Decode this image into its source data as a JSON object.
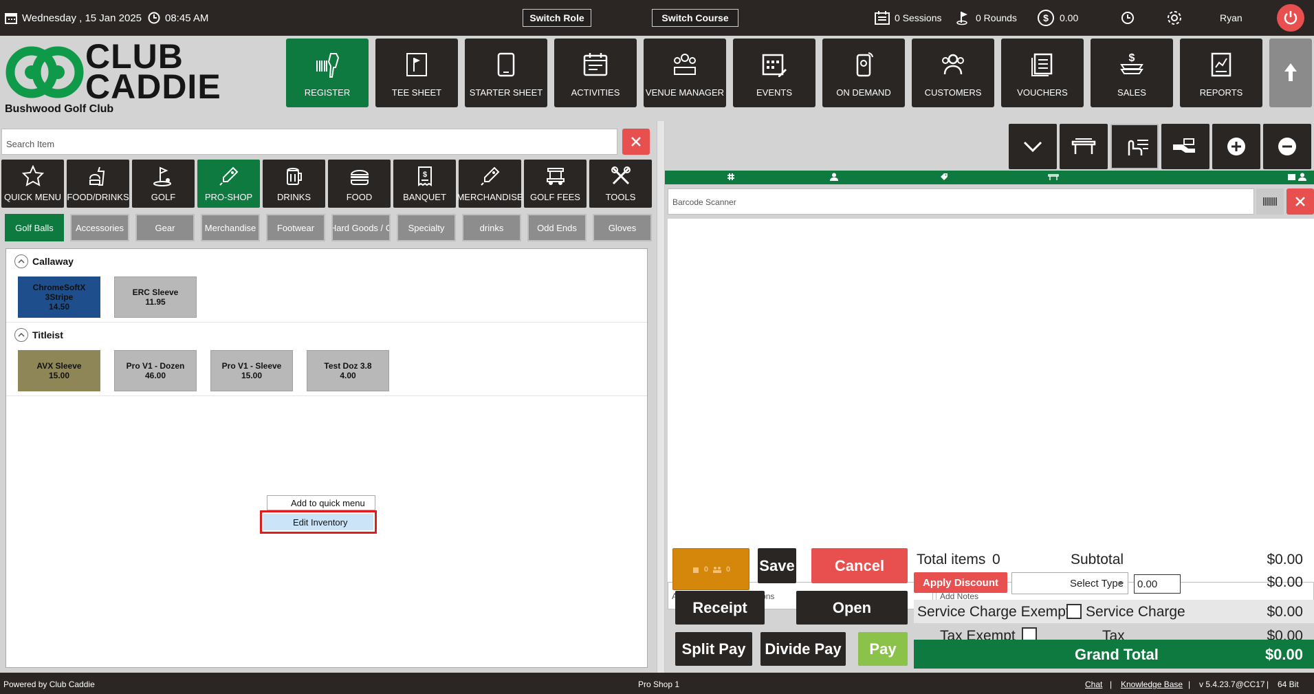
{
  "topbar": {
    "date": "Wednesday ,  15 Jan 2025",
    "time": "08:45 AM",
    "switch_role": "Switch Role",
    "switch_course": "Switch Course",
    "sessions": "0 Sessions",
    "rounds": "0 Rounds",
    "balance": "0.00",
    "user": "Ryan"
  },
  "logo": {
    "line1": "CLUB",
    "line2": "CADDIE",
    "club_name": "Bushwood Golf Club"
  },
  "nav": [
    "REGISTER",
    "TEE SHEET",
    "STARTER SHEET",
    "ACTIVITIES",
    "VENUE MANAGER",
    "EVENTS",
    "ON DEMAND",
    "CUSTOMERS",
    "VOUCHERS",
    "SALES",
    "REPORTS"
  ],
  "search": {
    "placeholder": "Search Item"
  },
  "categories": [
    "QUICK MENU",
    "FOOD/DRINKS",
    "GOLF",
    "PRO-SHOP",
    "DRINKS",
    "FOOD",
    "BANQUET",
    "MERCHANDISE",
    "GOLF FEES",
    "TOOLS"
  ],
  "subcategories": [
    "Golf Balls",
    "Accessories",
    "Gear",
    "Merchandise",
    "Footwear",
    "Hard Goods / C",
    "Specialty",
    "drinks",
    "Odd Ends",
    "Gloves"
  ],
  "groups": [
    {
      "name": "Callaway",
      "items": [
        {
          "name": "ChromeSoftX 3Stripe",
          "price": "14.50"
        },
        {
          "name": "ERC Sleeve",
          "price": "11.95"
        }
      ]
    },
    {
      "name": "Titleist",
      "items": [
        {
          "name": "AVX Sleeve",
          "price": "15.00"
        },
        {
          "name": "Pro V1 - Dozen",
          "price": "46.00"
        },
        {
          "name": "Pro V1 - Sleeve",
          "price": "15.00"
        },
        {
          "name": "Test Doz 3.8",
          "price": "4.00"
        }
      ]
    }
  ],
  "context_menu": {
    "item1": "Add to quick menu",
    "item2": "Edit Inventory"
  },
  "order": {
    "barcode_placeholder": "Barcode Scanner",
    "prep_placeholder": "Add preparation instructions",
    "notes_placeholder": "Add Notes",
    "tile_counts": [
      "0",
      "0"
    ]
  },
  "actions": {
    "save": "Save",
    "cancel": "Cancel",
    "receipt": "Receipt",
    "open": "Open",
    "split_pay": "Split Pay",
    "divide_pay": "Divide Pay",
    "pay": "Pay",
    "apply_discount": "Apply Discount",
    "select_type": "Select Type",
    "discount_value": "0.00"
  },
  "totals": {
    "total_items_label": "Total items",
    "total_items": "0",
    "subtotal_label": "Subtotal",
    "subtotal": "$0.00",
    "discount": "$0.00",
    "service_exempt_label": "Service Charge Exempt",
    "service_label": "Service Charge",
    "service": "$0.00",
    "tax_exempt_label": "Tax Exempt",
    "tax_label": "Tax",
    "tax": "$0.00",
    "grand_label": "Grand Total",
    "grand": "$0.00"
  },
  "footer": {
    "powered": "Powered by Club Caddie",
    "station": "Pro Shop 1",
    "chat": "Chat",
    "kb": "Knowledge Base",
    "version": "v 5.4.23.7@CC17",
    "bits": "64 Bit"
  },
  "colors": {
    "accent": "#0f7a3f",
    "danger": "#e8504f",
    "dark": "#2a2624",
    "pay": "#8bc34a",
    "orange": "#d4870a"
  }
}
